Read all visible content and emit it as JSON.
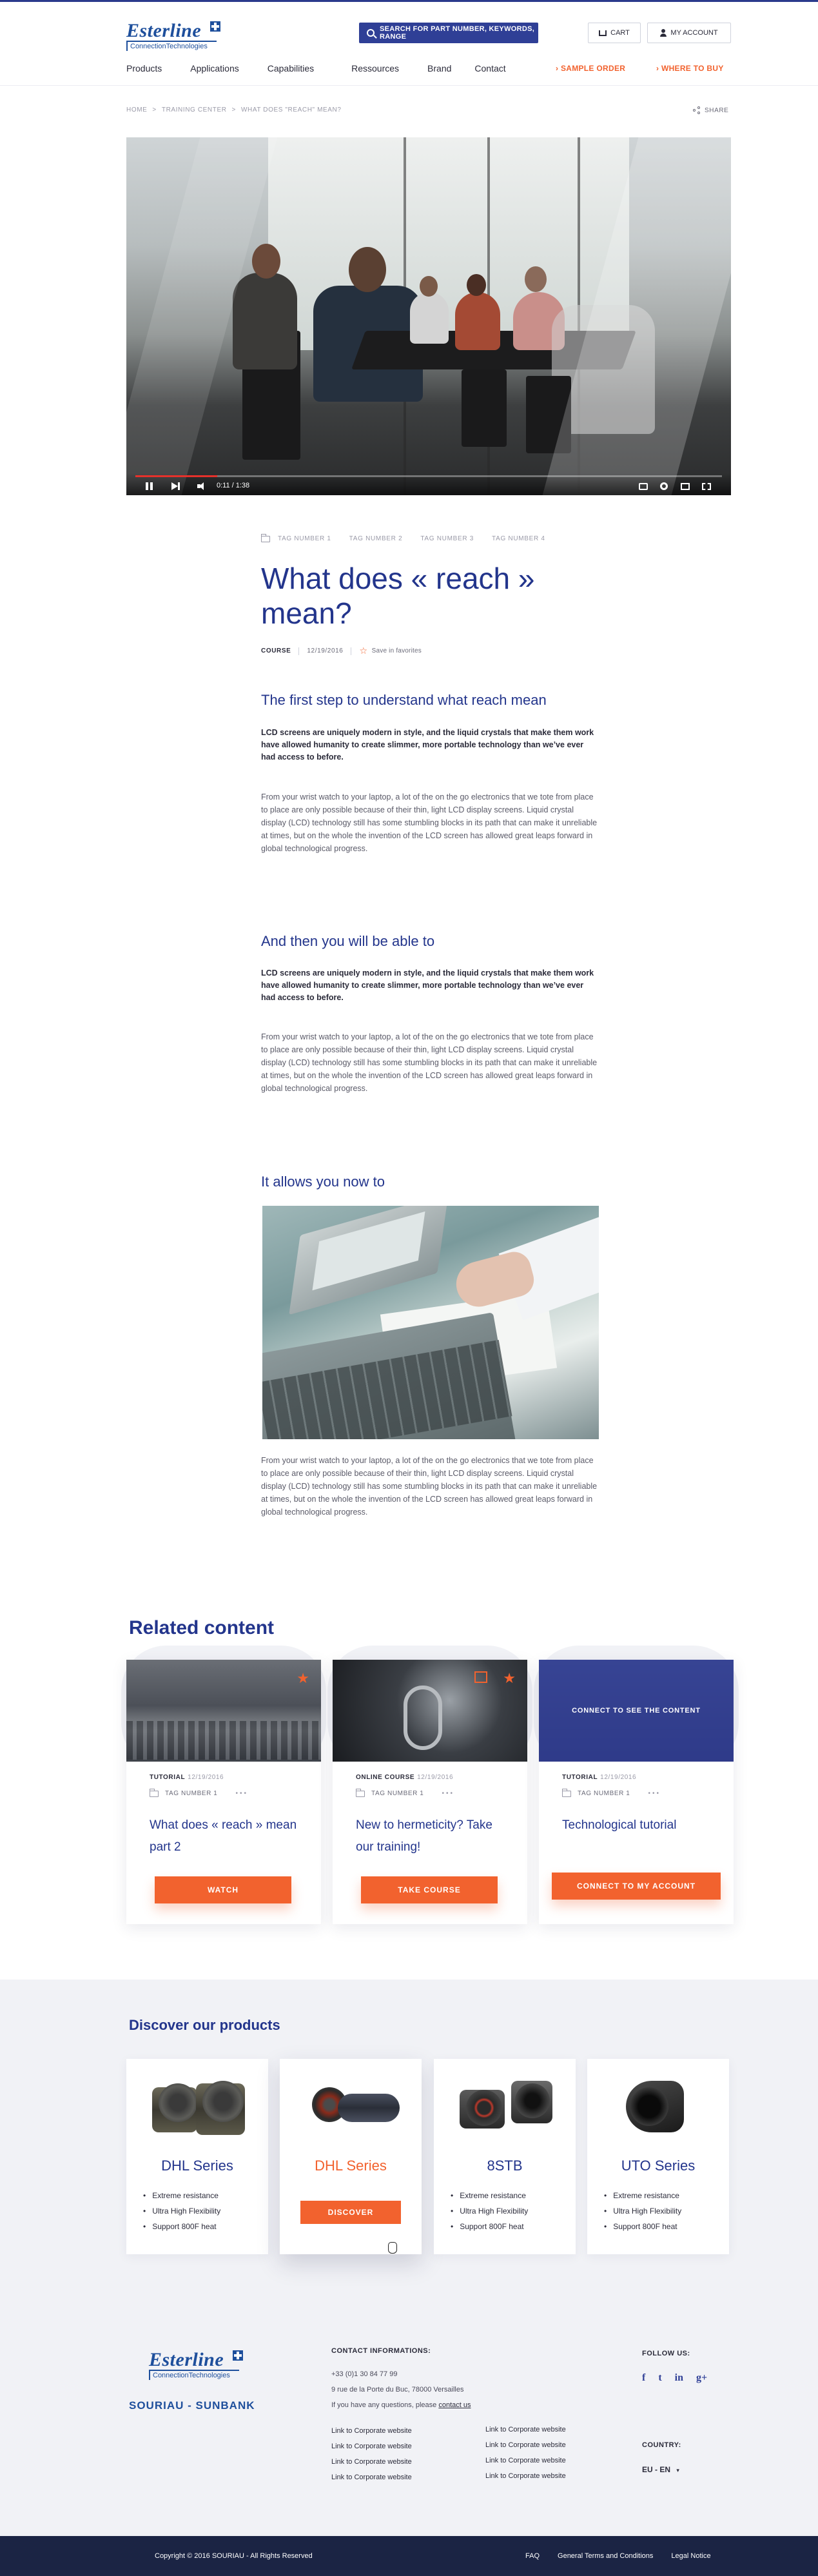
{
  "header": {
    "logo_text": "Esterline",
    "logo_sub": "ConnectionTechnologies",
    "search_label": "SEARCH FOR PART NUMBER, KEYWORDS, RANGE",
    "cart_label": "CART",
    "account_label": "MY ACCOUNT",
    "nav": [
      "Products",
      "Applications",
      "Capabilities",
      "Ressources",
      "Brand",
      "Contact"
    ],
    "sample_order": "SAMPLE ORDER",
    "where_to_buy": "WHERE TO BUY"
  },
  "breadcrumb": {
    "items": [
      "HOME",
      "TRAINING CENTER",
      "WHAT DOES \"REACH\" MEAN?"
    ],
    "separator": ">",
    "share_label": "SHARE"
  },
  "video": {
    "time": "0:11 / 1:38",
    "progress_fraction": 0.14
  },
  "article": {
    "tags": [
      "TAG NUMBER 1",
      "TAG NUMBER 2",
      "TAG NUMBER 3",
      "TAG NUMBER 4"
    ],
    "title": "What does « reach » mean?",
    "meta_type": "COURSE",
    "meta_date": "12/19/2016",
    "favorites": "Save in favorites",
    "sections": [
      {
        "heading": "The first step to understand what reach mean",
        "lead": "LCD screens are uniquely modern in style, and the liquid crystals that make them work have allowed humanity to create slimmer, more portable technology than we’ve ever had access to before.",
        "body": "From your wrist watch to your laptop, a lot of the on the go electronics that we tote from place to place are only possible because of their thin, light LCD display screens. Liquid crystal display (LCD) technology still has some stumbling blocks in its path that can make it unreliable at times, but on the whole the invention of the LCD screen has allowed great leaps forward in global technological progress."
      },
      {
        "heading": "And then you will be able to",
        "lead": "LCD screens are uniquely modern in style, and the liquid crystals that make them work have allowed humanity to create slimmer, more portable technology than we’ve ever had access to before.",
        "body": "From your wrist watch to your laptop, a lot of the on the go electronics that we tote from place to place are only possible because of their thin, light LCD display screens. Liquid crystal display (LCD) technology still has some stumbling blocks in its path that can make it unreliable at times, but on the whole the invention of the LCD screen has allowed great leaps forward in global technological progress."
      },
      {
        "heading": "It allows you now to",
        "body": "From your wrist watch to your laptop, a lot of the on the go electronics that we tote from place to place are only possible because of their thin, light LCD display screens. Liquid crystal display (LCD) technology still has some stumbling blocks in its path that can make it unreliable at times, but on the whole the invention of the LCD screen has allowed great leaps forward in global technological progress."
      }
    ]
  },
  "related": {
    "title": "Related content",
    "cards": [
      {
        "category": "TUTORIAL",
        "date": "12/19/2016",
        "tag": "TAG NUMBER 1",
        "more": "•••",
        "title": "What does « reach » mean part 2",
        "button": "WATCH"
      },
      {
        "category": "ONLINE COURSE",
        "date": "12/19/2016",
        "tag": "TAG NUMBER 1",
        "more": "•••",
        "title": "New to hermeticity? Take our training!",
        "button": "TAKE COURSE"
      },
      {
        "category": "TUTORIAL",
        "date": "12/19/2016",
        "tag": "TAG NUMBER 1",
        "more": "•••",
        "title": "Technological tutorial",
        "button": "CONNECT TO MY ACCOUNT",
        "overlay": "CONNECT TO SEE THE CONTENT"
      }
    ]
  },
  "products": {
    "title": "Discover our products",
    "items": [
      {
        "name": "DHL Series",
        "features": [
          "Extreme resistance",
          "Ultra High Flexibility",
          "Support 800F heat"
        ]
      },
      {
        "name": "DHL Series",
        "button": "DISCOVER"
      },
      {
        "name": "8STB",
        "features": [
          "Extreme resistance",
          "Ultra High Flexibility",
          "Support 800F heat"
        ]
      },
      {
        "name": "UTO Series",
        "features": [
          "Extreme resistance",
          "Ultra High Flexibility",
          "Support 800F heat"
        ]
      }
    ]
  },
  "footer": {
    "brand_secondary": "SOURIAU - SUNBANK",
    "contact_heading": "CONTACT INFORMATIONS:",
    "phone": "+33 (0)1 30 84 77 99",
    "address": "9 rue de la Porte du Buc, 78000 Versailles",
    "question": "If you have any questions, please",
    "contact_link": "contact us",
    "links_col1": [
      "Link to Corporate website",
      "Link to Corporate website",
      "Link to Corporate website",
      "Link to Corporate website"
    ],
    "links_col2": [
      "Link to Corporate website",
      "Link to Corporate website",
      "Link to Corporate website",
      "Link to Corporate website"
    ],
    "follow_heading": "FOLLOW US:",
    "social": [
      "f",
      "t",
      "in",
      "g+"
    ],
    "country_heading": "COUNTRY:",
    "country_value": "EU - EN",
    "copyright": "Copyright © 2016 SOURIAU - All Rights Reserved",
    "bottom_links": [
      "FAQ",
      "General Terms and Conditions",
      "Legal Notice"
    ]
  },
  "colors": {
    "brand_blue": "#23358c",
    "accent_orange": "#f2622e",
    "footer_dark": "#1b2444"
  }
}
